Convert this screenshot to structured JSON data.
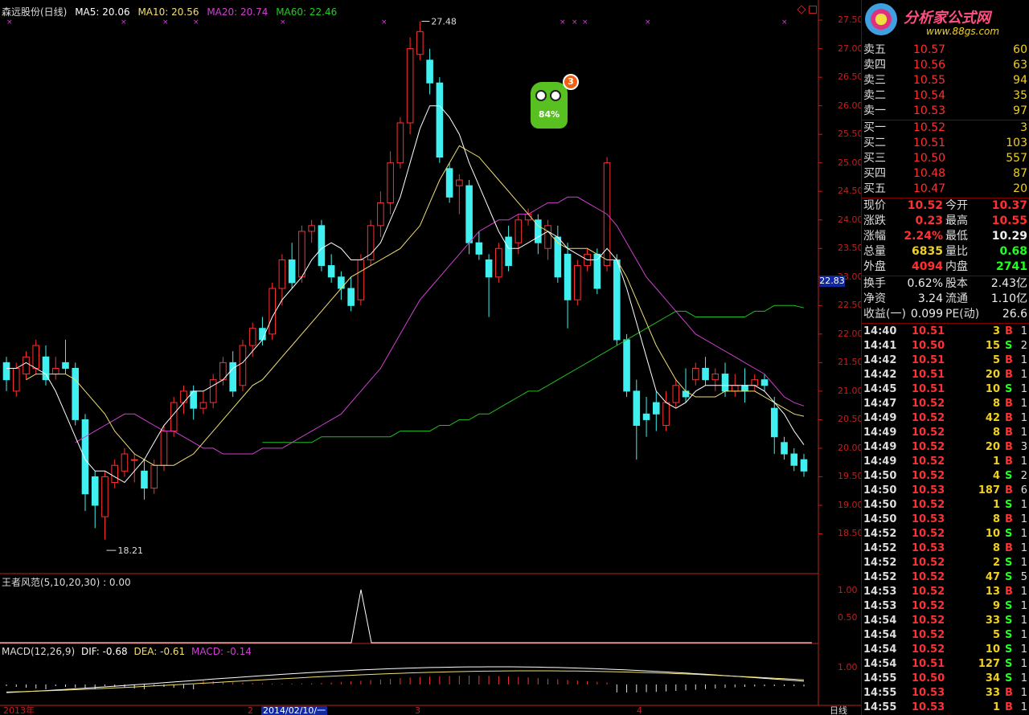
{
  "header": {
    "stock_title": "森远股份(日线)",
    "ma5": "MA5: 20.06",
    "ma10": "MA10: 20.56",
    "ma20": "MA20: 20.74",
    "ma60": "MA60: 22.46"
  },
  "colors": {
    "up": "#ff3030",
    "down": "#40f0f0",
    "ma5": "#ffffff",
    "ma10": "#f0e070",
    "ma20": "#d040d0",
    "ma60": "#20c020",
    "axis": "#c02020"
  },
  "price_axis": {
    "ticks": [
      "27.50",
      "27.00",
      "26.50",
      "26.00",
      "25.50",
      "25.00",
      "24.50",
      "24.00",
      "23.50",
      "23.00",
      "22.50",
      "22.00",
      "21.50",
      "21.00",
      "20.50",
      "20.00",
      "19.50",
      "19.00",
      "18.50"
    ],
    "current_marker": "22.83",
    "high_label": "27.48",
    "low_label": "18.21"
  },
  "badge": {
    "count": "3",
    "percent": "84%"
  },
  "indicator1": {
    "title": "王者风范(5,10,20,30) : 0.00",
    "ticks": [
      "1.00",
      "0.50"
    ]
  },
  "macd": {
    "title": "MACD(12,26,9)",
    "dif": "DIF: -0.68",
    "dea": "DEA: -0.61",
    "macd": "MACD: -0.14",
    "ticks": [
      "1.00"
    ]
  },
  "xaxis": {
    "year": "2013年",
    "m2": "2",
    "date_box": "2014/02/10/一",
    "m3": "3",
    "m4": "4",
    "period": "日线"
  },
  "chart_data": {
    "type": "candlestick",
    "ylim": [
      18.0,
      27.6
    ],
    "candles": [
      [
        21.5,
        21.2,
        21.6,
        21.0
      ],
      [
        21.0,
        21.4,
        21.5,
        20.9
      ],
      [
        21.3,
        21.6,
        21.7,
        21.2
      ],
      [
        21.4,
        21.8,
        21.9,
        21.3
      ],
      [
        21.6,
        21.2,
        21.8,
        21.1
      ],
      [
        21.3,
        21.4,
        21.6,
        21.2
      ],
      [
        21.5,
        21.4,
        21.9,
        21.3
      ],
      [
        21.4,
        20.5,
        21.5,
        20.4
      ],
      [
        20.5,
        19.2,
        20.6,
        18.9
      ],
      [
        19.5,
        19.0,
        19.6,
        18.6
      ],
      [
        18.8,
        19.5,
        19.6,
        18.4
      ],
      [
        19.4,
        19.7,
        19.8,
        19.3
      ],
      [
        19.6,
        19.9,
        20.0,
        19.5
      ],
      [
        19.8,
        19.8,
        19.9,
        19.4
      ],
      [
        19.6,
        19.3,
        19.8,
        19.1
      ],
      [
        19.3,
        19.7,
        19.8,
        19.2
      ],
      [
        19.7,
        20.3,
        20.4,
        19.6
      ],
      [
        20.3,
        20.8,
        20.9,
        20.2
      ],
      [
        20.8,
        21.0,
        21.1,
        20.6
      ],
      [
        21.0,
        20.7,
        21.1,
        20.5
      ],
      [
        20.7,
        20.8,
        21.0,
        20.6
      ],
      [
        20.8,
        21.2,
        21.3,
        20.7
      ],
      [
        21.2,
        21.5,
        21.6,
        21.1
      ],
      [
        21.5,
        21.0,
        21.7,
        20.9
      ],
      [
        21.1,
        21.8,
        21.9,
        21.0
      ],
      [
        21.8,
        22.1,
        22.2,
        21.6
      ],
      [
        22.1,
        21.9,
        22.3,
        21.8
      ],
      [
        22.0,
        22.8,
        22.9,
        21.9
      ],
      [
        22.8,
        23.3,
        23.4,
        22.5
      ],
      [
        23.3,
        22.9,
        23.6,
        22.8
      ],
      [
        23.0,
        23.8,
        23.9,
        22.9
      ],
      [
        23.8,
        23.9,
        24.0,
        23.6
      ],
      [
        23.9,
        23.2,
        24.0,
        23.1
      ],
      [
        23.2,
        23.0,
        23.4,
        22.9
      ],
      [
        23.0,
        22.8,
        23.1,
        22.6
      ],
      [
        22.8,
        22.5,
        23.0,
        22.4
      ],
      [
        22.6,
        23.3,
        23.4,
        22.5
      ],
      [
        23.3,
        23.9,
        24.0,
        23.2
      ],
      [
        23.9,
        24.3,
        24.5,
        23.7
      ],
      [
        24.3,
        25.0,
        25.2,
        24.1
      ],
      [
        25.0,
        25.7,
        25.8,
        24.9
      ],
      [
        25.7,
        27.0,
        27.2,
        25.5
      ],
      [
        26.9,
        27.3,
        27.48,
        26.8
      ],
      [
        26.8,
        26.4,
        27.0,
        26.2
      ],
      [
        26.4,
        25.1,
        26.5,
        25.0
      ],
      [
        24.9,
        24.4,
        25.0,
        24.3
      ],
      [
        24.6,
        24.7,
        24.8,
        24.1
      ],
      [
        24.6,
        23.6,
        24.7,
        23.4
      ],
      [
        23.6,
        23.4,
        23.8,
        23.3
      ],
      [
        23.3,
        23.0,
        23.4,
        22.3
      ],
      [
        23.0,
        23.5,
        23.6,
        22.9
      ],
      [
        23.7,
        23.2,
        23.9,
        23.1
      ],
      [
        23.6,
        24.0,
        24.1,
        23.4
      ],
      [
        24.0,
        24.1,
        24.2,
        23.9
      ],
      [
        24.0,
        23.6,
        24.1,
        23.4
      ],
      [
        23.5,
        23.9,
        24.0,
        23.3
      ],
      [
        23.7,
        23.0,
        23.9,
        22.9
      ],
      [
        23.4,
        22.6,
        23.6,
        22.1
      ],
      [
        22.6,
        23.2,
        23.3,
        22.5
      ],
      [
        23.2,
        23.4,
        23.5,
        23.1
      ],
      [
        23.4,
        22.8,
        23.5,
        22.7
      ],
      [
        23.2,
        25.0,
        25.1,
        23.1
      ],
      [
        23.3,
        21.9,
        23.4,
        21.8
      ],
      [
        21.9,
        21.0,
        22.0,
        20.9
      ],
      [
        21.0,
        20.4,
        21.2,
        19.8
      ],
      [
        20.6,
        20.5,
        20.9,
        20.2
      ],
      [
        20.8,
        20.6,
        21.0,
        20.3
      ],
      [
        20.4,
        20.8,
        21.0,
        20.3
      ],
      [
        20.8,
        21.1,
        21.2,
        20.7
      ],
      [
        21.0,
        20.9,
        21.4,
        20.8
      ],
      [
        21.2,
        21.4,
        21.5,
        21.1
      ],
      [
        21.4,
        21.2,
        21.6,
        21.1
      ],
      [
        21.2,
        21.3,
        21.4,
        21.0
      ],
      [
        21.3,
        21.0,
        21.5,
        20.9
      ],
      [
        21.0,
        21.1,
        21.3,
        20.9
      ],
      [
        21.1,
        21.0,
        21.4,
        20.8
      ],
      [
        21.1,
        21.2,
        21.3,
        21.0
      ],
      [
        21.2,
        21.1,
        21.3,
        21.0
      ],
      [
        20.7,
        20.2,
        20.9,
        19.9
      ],
      [
        20.1,
        19.9,
        20.2,
        19.8
      ],
      [
        19.9,
        19.7,
        20.0,
        19.6
      ],
      [
        19.8,
        19.6,
        19.9,
        19.5
      ]
    ],
    "ma5": [
      21.4,
      21.4,
      21.5,
      21.4,
      21.3,
      21.0,
      20.6,
      20.2,
      19.8,
      19.6,
      19.6,
      19.5,
      19.4,
      19.6,
      19.8,
      20.1,
      20.4,
      20.6,
      20.8,
      21.0,
      21.0,
      21.1,
      21.2,
      21.4,
      21.5,
      21.7,
      21.9,
      22.3,
      22.6,
      22.8,
      23.0,
      23.3,
      23.5,
      23.6,
      23.5,
      23.3,
      23.3,
      23.4,
      23.6,
      24.0,
      24.4,
      25.0,
      25.6,
      26.0,
      26.0,
      25.8,
      25.5,
      25.0,
      24.6,
      24.2,
      23.8,
      23.5,
      23.5,
      23.6,
      23.7,
      23.8,
      23.7,
      23.5,
      23.4,
      23.3,
      23.3,
      23.5,
      23.3,
      22.8,
      22.2,
      21.6,
      21.0,
      20.8,
      20.7,
      20.8,
      21.0,
      21.1,
      21.1,
      21.1,
      21.1,
      21.1,
      21.1,
      21.0,
      20.8,
      20.6,
      20.3,
      20.06
    ],
    "ma10": [
      21.2,
      21.3,
      21.3,
      21.3,
      21.3,
      21.2,
      21.0,
      20.8,
      20.6,
      20.3,
      20.1,
      19.9,
      19.8,
      19.7,
      19.7,
      19.7,
      19.8,
      19.9,
      20.1,
      20.3,
      20.5,
      20.7,
      20.9,
      21.1,
      21.2,
      21.4,
      21.6,
      21.8,
      22.0,
      22.2,
      22.4,
      22.6,
      22.8,
      23.0,
      23.1,
      23.2,
      23.3,
      23.4,
      23.5,
      23.7,
      23.9,
      24.3,
      24.7,
      25.0,
      25.3,
      25.2,
      25.1,
      24.9,
      24.7,
      24.5,
      24.3,
      24.1,
      23.9,
      23.8,
      23.6,
      23.5,
      23.5,
      23.5,
      23.4,
      23.3,
      23.3,
      23.0,
      22.6,
      22.2,
      21.8,
      21.5,
      21.2,
      21.0,
      20.9,
      20.9,
      20.9,
      21.0,
      21.0,
      21.0,
      21.0,
      20.9,
      20.8,
      20.7,
      20.6,
      20.56
    ],
    "ma20": [
      20.1,
      20.2,
      20.3,
      20.4,
      20.5,
      20.6,
      20.6,
      20.5,
      20.4,
      20.3,
      20.3,
      20.2,
      20.1,
      20.0,
      20.0,
      19.9,
      19.9,
      19.9,
      19.9,
      20.0,
      20.0,
      20.0,
      20.1,
      20.2,
      20.3,
      20.4,
      20.5,
      20.6,
      20.8,
      21.0,
      21.2,
      21.4,
      21.7,
      22.0,
      22.3,
      22.6,
      22.8,
      23.0,
      23.2,
      23.4,
      23.6,
      23.8,
      23.9,
      24.0,
      24.0,
      24.1,
      24.1,
      24.2,
      24.3,
      24.3,
      24.4,
      24.4,
      24.3,
      24.2,
      24.1,
      23.9,
      23.6,
      23.3,
      23.0,
      22.8,
      22.6,
      22.4,
      22.2,
      22.0,
      21.9,
      21.8,
      21.7,
      21.6,
      21.5,
      21.4,
      21.3,
      21.1,
      20.9,
      20.8,
      20.74
    ],
    "ma60": [
      20.1,
      20.1,
      20.1,
      20.1,
      20.1,
      20.1,
      20.2,
      20.2,
      20.2,
      20.2,
      20.2,
      20.2,
      20.2,
      20.2,
      20.3,
      20.3,
      20.3,
      20.3,
      20.4,
      20.4,
      20.5,
      20.5,
      20.6,
      20.6,
      20.7,
      20.8,
      20.9,
      21.0,
      21.0,
      21.1,
      21.2,
      21.3,
      21.4,
      21.5,
      21.6,
      21.7,
      21.8,
      21.9,
      22.0,
      22.1,
      22.2,
      22.3,
      22.4,
      22.4,
      22.3,
      22.3,
      22.3,
      22.3,
      22.3,
      22.3,
      22.4,
      22.4,
      22.5,
      22.5,
      22.5,
      22.46
    ]
  },
  "right_panel": {
    "logo_title": "分析家公式网",
    "logo_url": "www.88gs.com",
    "sell": [
      {
        "label": "卖五",
        "price": "10.57",
        "vol": "60"
      },
      {
        "label": "卖四",
        "price": "10.56",
        "vol": "63"
      },
      {
        "label": "卖三",
        "price": "10.55",
        "vol": "94"
      },
      {
        "label": "卖二",
        "price": "10.54",
        "vol": "35"
      },
      {
        "label": "卖一",
        "price": "10.53",
        "vol": "97"
      }
    ],
    "buy": [
      {
        "label": "买一",
        "price": "10.52",
        "vol": "3"
      },
      {
        "label": "买二",
        "price": "10.51",
        "vol": "103"
      },
      {
        "label": "买三",
        "price": "10.50",
        "vol": "557"
      },
      {
        "label": "买四",
        "price": "10.48",
        "vol": "87"
      },
      {
        "label": "买五",
        "price": "10.47",
        "vol": "20"
      }
    ],
    "quote": [
      {
        "l1": "现价",
        "v1": "10.52",
        "c1": "red",
        "l2": "今开",
        "v2": "10.37",
        "c2": "red"
      },
      {
        "l1": "涨跌",
        "v1": "0.23",
        "c1": "red",
        "l2": "最高",
        "v2": "10.55",
        "c2": "red"
      },
      {
        "l1": "涨幅",
        "v1": "2.24%",
        "c1": "red",
        "l2": "最低",
        "v2": "10.29",
        "c2": "white"
      },
      {
        "l1": "总量",
        "v1": "6835",
        "c1": "yellow",
        "l2": "量比",
        "v2": "0.68",
        "c2": "green"
      },
      {
        "l1": "外盘",
        "v1": "4094",
        "c1": "red",
        "l2": "内盘",
        "v2": "2741",
        "c2": "green"
      }
    ],
    "finance": [
      {
        "l1": "换手",
        "v1": "0.62%",
        "l2": "股本",
        "v2": "2.43亿"
      },
      {
        "l1": "净资",
        "v1": "3.24",
        "l2": "流通",
        "v2": "1.10亿"
      },
      {
        "l1": "收益(一)",
        "v1": "0.099",
        "l2": "PE(动)",
        "v2": "26.6"
      }
    ],
    "ticks": [
      {
        "time": "14:40",
        "price": "10.51",
        "vol": "3",
        "bs": "B",
        "n": "1"
      },
      {
        "time": "14:41",
        "price": "10.50",
        "vol": "15",
        "bs": "S",
        "n": "2"
      },
      {
        "time": "14:42",
        "price": "10.51",
        "vol": "5",
        "bs": "B",
        "n": "1"
      },
      {
        "time": "14:42",
        "price": "10.51",
        "vol": "20",
        "bs": "B",
        "n": "1"
      },
      {
        "time": "14:45",
        "price": "10.51",
        "vol": "10",
        "bs": "S",
        "n": "1"
      },
      {
        "time": "14:47",
        "price": "10.52",
        "vol": "8",
        "bs": "B",
        "n": "1"
      },
      {
        "time": "14:49",
        "price": "10.52",
        "vol": "42",
        "bs": "B",
        "n": "1"
      },
      {
        "time": "14:49",
        "price": "10.52",
        "vol": "8",
        "bs": "B",
        "n": "1"
      },
      {
        "time": "14:49",
        "price": "10.52",
        "vol": "20",
        "bs": "B",
        "n": "3"
      },
      {
        "time": "14:49",
        "price": "10.52",
        "vol": "1",
        "bs": "B",
        "n": "1"
      },
      {
        "time": "14:50",
        "price": "10.52",
        "vol": "4",
        "bs": "S",
        "n": "2"
      },
      {
        "time": "14:50",
        "price": "10.53",
        "vol": "187",
        "bs": "B",
        "n": "6"
      },
      {
        "time": "14:50",
        "price": "10.52",
        "vol": "1",
        "bs": "S",
        "n": "1"
      },
      {
        "time": "14:50",
        "price": "10.53",
        "vol": "8",
        "bs": "B",
        "n": "1"
      },
      {
        "time": "14:52",
        "price": "10.52",
        "vol": "10",
        "bs": "S",
        "n": "1"
      },
      {
        "time": "14:52",
        "price": "10.53",
        "vol": "8",
        "bs": "B",
        "n": "1"
      },
      {
        "time": "14:52",
        "price": "10.52",
        "vol": "2",
        "bs": "S",
        "n": "1"
      },
      {
        "time": "14:52",
        "price": "10.52",
        "vol": "47",
        "bs": "S",
        "n": "5"
      },
      {
        "time": "14:53",
        "price": "10.52",
        "vol": "13",
        "bs": "B",
        "n": "1"
      },
      {
        "time": "14:53",
        "price": "10.52",
        "vol": "9",
        "bs": "S",
        "n": "1"
      },
      {
        "time": "14:54",
        "price": "10.52",
        "vol": "33",
        "bs": "S",
        "n": "1"
      },
      {
        "time": "14:54",
        "price": "10.52",
        "vol": "5",
        "bs": "S",
        "n": "1"
      },
      {
        "time": "14:54",
        "price": "10.52",
        "vol": "10",
        "bs": "S",
        "n": "1"
      },
      {
        "time": "14:54",
        "price": "10.51",
        "vol": "127",
        "bs": "S",
        "n": "1"
      },
      {
        "time": "14:55",
        "price": "10.50",
        "vol": "34",
        "bs": "S",
        "n": "1"
      },
      {
        "time": "14:55",
        "price": "10.53",
        "vol": "33",
        "bs": "B",
        "n": "1"
      },
      {
        "time": "14:55",
        "price": "10.53",
        "vol": "1",
        "bs": "B",
        "n": "1"
      }
    ]
  }
}
